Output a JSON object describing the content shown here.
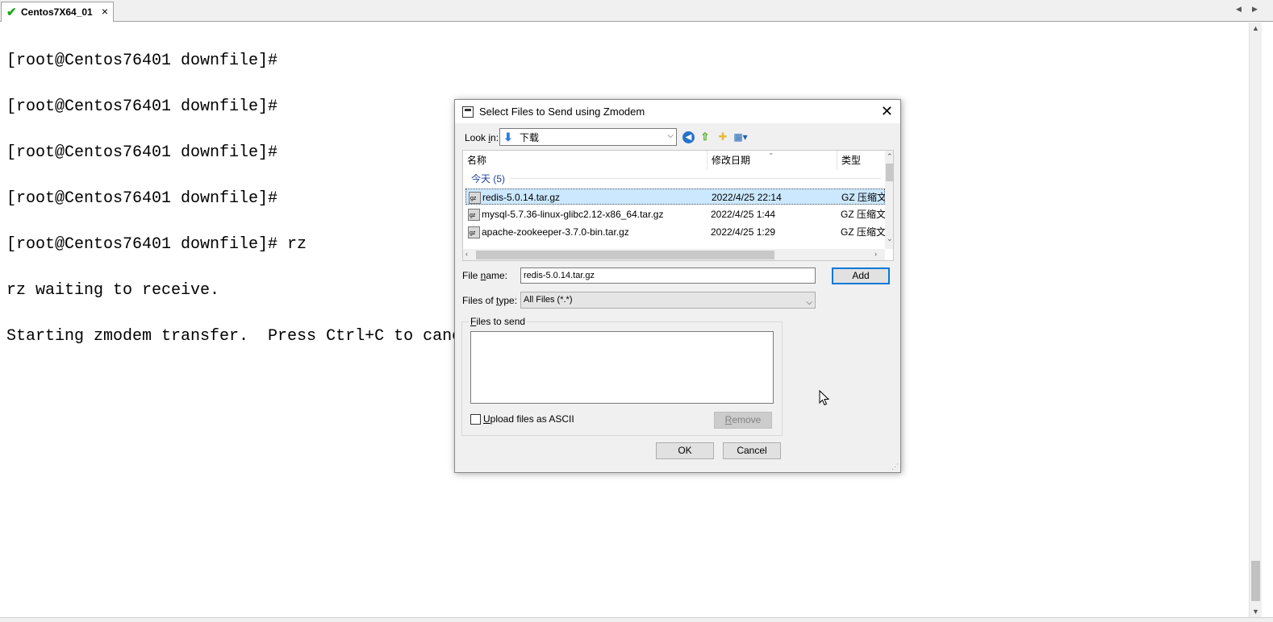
{
  "tabs": [
    {
      "title": "Centos7X64_01",
      "status": "connected"
    }
  ],
  "terminal": {
    "lines": [
      "[root@Centos76401 downfile]#",
      "[root@Centos76401 downfile]#",
      "[root@Centos76401 downfile]#",
      "[root@Centos76401 downfile]#",
      "[root@Centos76401 downfile]# rz",
      "rz waiting to receive.",
      "Starting zmodem transfer.  Press Ctrl+C to cancel."
    ]
  },
  "dialog": {
    "title": "Select Files to Send using Zmodem",
    "look_in_label": "Look in:",
    "look_in_value": "下载",
    "columns": [
      "名称",
      "修改日期",
      "类型"
    ],
    "group_label": "今天 (5)",
    "files": [
      {
        "name": "redis-5.0.14.tar.gz",
        "date": "2022/4/25 22:14",
        "type": "GZ 压缩文件",
        "selected": true
      },
      {
        "name": "mysql-5.7.36-linux-glibc2.12-x86_64.tar.gz",
        "date": "2022/4/25 1:44",
        "type": "GZ 压缩文件",
        "selected": false
      },
      {
        "name": "apache-zookeeper-3.7.0-bin.tar.gz",
        "date": "2022/4/25 1:29",
        "type": "GZ 压缩文件",
        "selected": false
      }
    ],
    "file_name_label": "File name:",
    "file_name_value": "redis-5.0.14.tar.gz",
    "add_label": "Add",
    "file_type_label": "Files of type:",
    "file_type_value": "All Files (*.*)",
    "files_to_send_label": "Files to send",
    "ascii_label": "Upload files as ASCII",
    "remove_label": "Remove",
    "ok_label": "OK",
    "cancel_label": "Cancel"
  },
  "colors": {
    "accent": "#0078d7",
    "selection": "#cce8ff",
    "connected": "#1aa81a"
  }
}
